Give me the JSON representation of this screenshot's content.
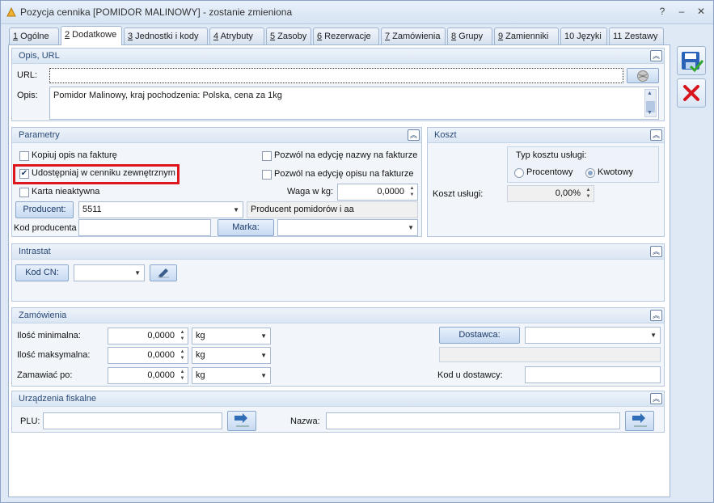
{
  "window": {
    "title": "Pozycja cennika [POMIDOR MALINOWY] - zostanie zmieniona"
  },
  "tabs": [
    {
      "key": "1",
      "label": " Ogólne"
    },
    {
      "key": "2",
      "label": " Dodatkowe"
    },
    {
      "key": "3",
      "label": " Jednostki i kody"
    },
    {
      "key": "4",
      "label": " Atrybuty"
    },
    {
      "key": "5",
      "label": " Zasoby"
    },
    {
      "key": "6",
      "label": " Rezerwacje"
    },
    {
      "key": "7",
      "label": " Zamówienia"
    },
    {
      "key": "8",
      "label": " Grupy"
    },
    {
      "key": "9",
      "label": " Zamienniki"
    },
    {
      "key": "",
      "label": "10 Języki"
    },
    {
      "key": "",
      "label": "11 Zestawy"
    }
  ],
  "opis": {
    "header": "Opis, URL",
    "url_label": "URL:",
    "url_value": "",
    "opis_label": "Opis:",
    "opis_value": "Pomidor Malinowy, kraj pochodzenia: Polska, cena za 1kg"
  },
  "parametry": {
    "header": "Parametry",
    "kopiuj_opis": "Kopiuj opis na fakturę",
    "udostepniaj": "Udostępniaj w cenniku zewnętrznym",
    "karta_nieaktywna": "Karta nieaktywna",
    "pozwol_nazwy": "Pozwól na edycję nazwy na fakturze",
    "pozwol_opisu": "Pozwól na edycję opisu na fakturze",
    "waga_label": "Waga w kg:",
    "waga_value": "0,0000",
    "producent_btn": "Producent:",
    "producent_value": "5511",
    "producent_name": "Producent pomidorów i aa",
    "kod_producenta_label": "Kod producenta",
    "kod_producenta_value": "",
    "marka_btn": "Marka:",
    "marka_value": ""
  },
  "koszt": {
    "header": "Koszt",
    "typ_label": "Typ kosztu usługi:",
    "procentowy": "Procentowy",
    "kwotowy": "Kwotowy",
    "koszt_label": "Koszt usługi:",
    "koszt_value": "0,00%"
  },
  "intrastat": {
    "header": "Intrastat",
    "kod_cn_btn": "Kod CN:",
    "kod_cn_value": ""
  },
  "zamowienia": {
    "header": "Zamówienia",
    "ilosc_min_label": "Ilość minimalna:",
    "ilosc_min_value": "0,0000",
    "ilosc_min_unit": "kg",
    "ilosc_max_label": "Ilość maksymalna:",
    "ilosc_max_value": "0,0000",
    "ilosc_max_unit": "kg",
    "zamawiac_label": "Zamawiać po:",
    "zamawiac_value": "0,0000",
    "zamawiac_unit": "kg",
    "dostawca_btn": "Dostawca:",
    "dostawca_value": "",
    "kod_dostawcy_label": "Kod u dostawcy:",
    "kod_dostawcy_value": ""
  },
  "fiskalne": {
    "header": "Urządzenia fiskalne",
    "plu_label": "PLU:",
    "plu_value": "",
    "nazwa_label": "Nazwa:",
    "nazwa_value": ""
  },
  "colors": {
    "highlight": "#e0161e",
    "accent": "#2a4a78"
  }
}
